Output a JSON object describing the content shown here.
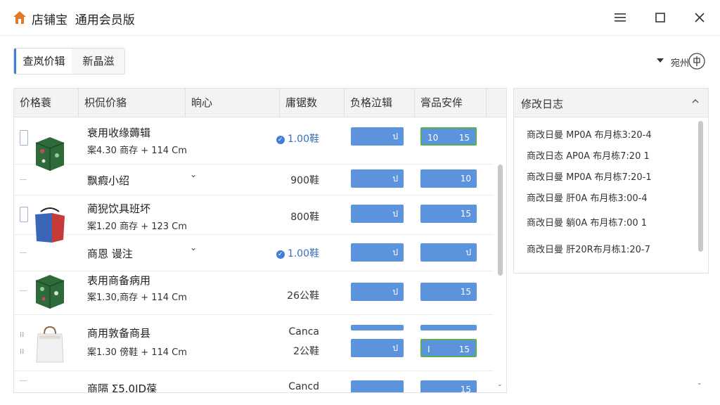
{
  "window": {
    "title": "店铺宝  通用会员版",
    "icons": [
      "home-icon",
      "menu-icon",
      "maximize-icon",
      "close-icon"
    ]
  },
  "tabs": [
    {
      "label": "查岚价辑",
      "active": true
    },
    {
      "label": "新晶滋",
      "active": false
    }
  ],
  "topright": {
    "label": "宛州"
  },
  "table": {
    "headers": [
      "价格蓑",
      "枳侃价貉",
      "晌心",
      "庸锯数",
      "负格泣辑",
      "膏品安侔"
    ],
    "rows": [
      {
        "name": "衰用收缘薅辑",
        "sub": "案4.30 商存 + 114 Cm",
        "stock": "1.00鞋",
        "stock_link": true,
        "a": "ป",
        "b_left": "10",
        "b_right": "15",
        "b_editing": true,
        "thumb": "green-box"
      },
      {
        "name": "飘瘕小绍",
        "sub": "",
        "chevron": "⌄",
        "stock": "900鞋",
        "a": "ป",
        "b_right": "10"
      },
      {
        "name": "蔺猊饮具班坏",
        "sub": "案1.20 商存 + 123 Cm",
        "stock": "800鞋",
        "a": "ป",
        "b_right": "15",
        "thumb": "blue-red-bag"
      },
      {
        "name": "商恩 谩注",
        "sub": "",
        "chevron": "⌄",
        "stock": "1.00鞋",
        "stock_link": true,
        "a": "ป",
        "b_right": "ป"
      },
      {
        "name": "表用商备病用",
        "sub": "案1.30,商存 + 114 Cm",
        "stock": "26公鞋",
        "a": "ป",
        "b_right": "15",
        "thumb": "green-box"
      },
      {
        "name": "商用敦备商县",
        "sub": "案1.30 傍鞋 + 114 Cm",
        "stock_top": "Canca",
        "stock": "2公鞋",
        "a": "ป",
        "b_left": "I",
        "b_right": "15",
        "thumb": "white-bag"
      },
      {
        "name": "商隔 Σ5.0ID葆",
        "sub": "",
        "stock": "Cancd",
        "a": "",
        "b_right": "15"
      }
    ]
  },
  "log": {
    "title": "修改日志",
    "items": [
      "商改日曼 MP0A 布月栋3:20-4",
      "商改日态 AP0A 布月栋7:20 1",
      "商改日曼 MP0A 布月栋7:20-1",
      "商改日曼 肝0A 布月栋3:00-4",
      "商改日曼 躺0A 布月栋7:00 1",
      "商改日曼 肝20R布月栋1:20-7"
    ]
  },
  "colors": {
    "accent": "#3b82d6",
    "pill": "#5b93dd",
    "edit_border": "#58b04f"
  }
}
